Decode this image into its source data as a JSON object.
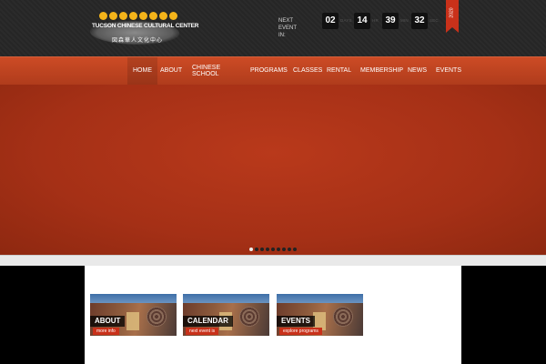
{
  "logo": {
    "name": "TUCSON CHINESE CULTURAL CENTER",
    "chinese": "図森華人文化中心",
    "dots": 8
  },
  "countdown": {
    "label": "NEXT EVENT IN:",
    "days": "02",
    "days_unit": "DAYS",
    "hours": "14",
    "hours_unit": "HR",
    "minutes": "39",
    "minutes_unit": "MIN",
    "seconds": "32",
    "seconds_unit": "SEC"
  },
  "ribbon": {
    "text": "2020"
  },
  "nav": {
    "items": [
      {
        "label": "HOME"
      },
      {
        "label": "ABOUT"
      },
      {
        "label": "CHINESE SCHOOL"
      },
      {
        "label": "PROGRAMS"
      },
      {
        "label": "CLASSES"
      },
      {
        "label": "RENTAL"
      },
      {
        "label": "MEMBERSHIP"
      },
      {
        "label": "NEWS"
      },
      {
        "label": "EVENTS"
      }
    ],
    "active": "HOME"
  },
  "slider": {
    "total": 9,
    "active_index": 0
  },
  "cards": [
    {
      "title": "ABOUT",
      "link": "more info"
    },
    {
      "title": "CALENDAR",
      "link": "next event is"
    },
    {
      "title": "EVENTS",
      "link": "explore programs"
    }
  ],
  "colors": {
    "accent": "#c9311a",
    "nav": "#b8411f",
    "topbar": "#2a2a2a",
    "logo_dot": "#f4b41a"
  }
}
